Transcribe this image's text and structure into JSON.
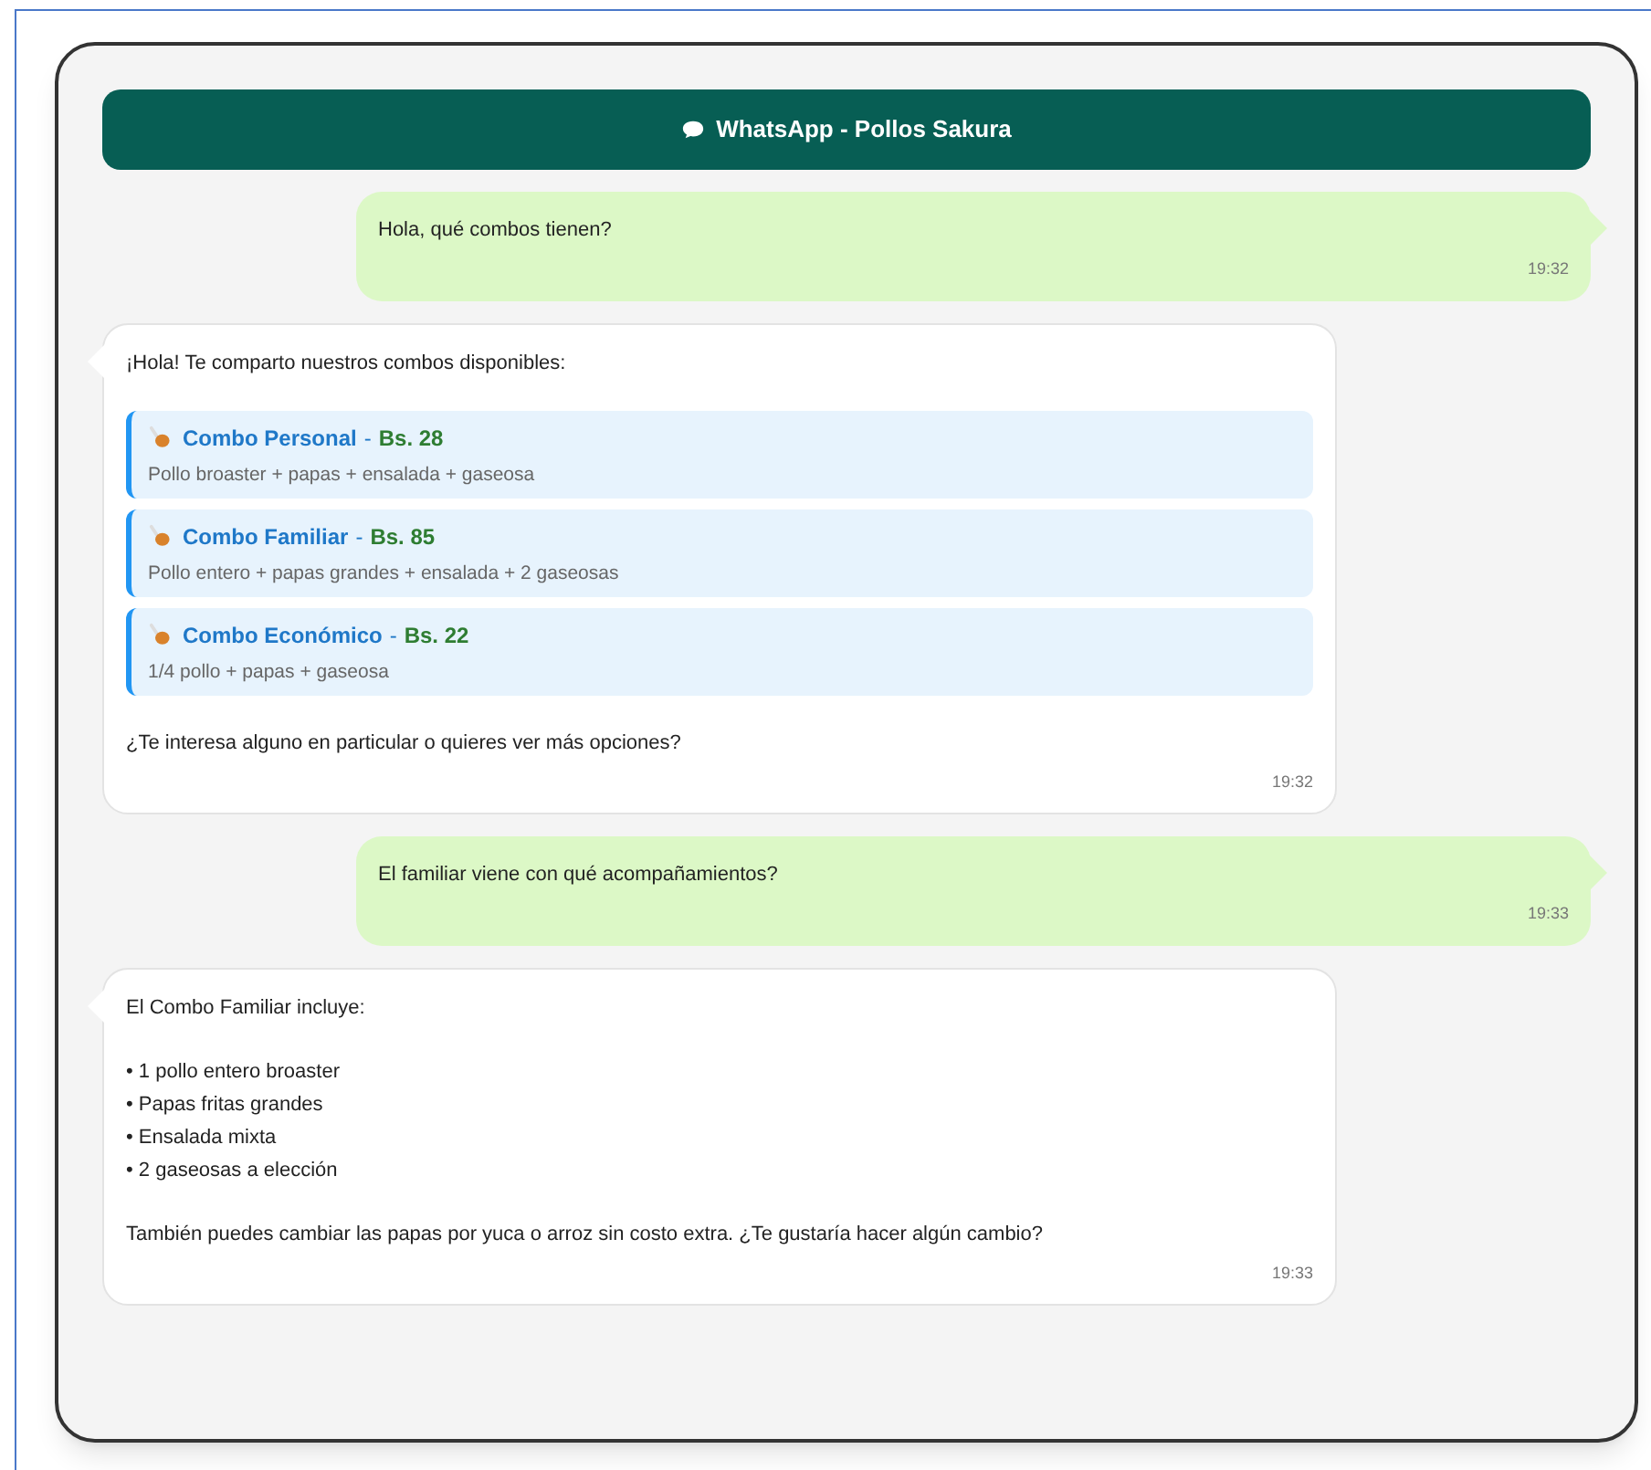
{
  "header": {
    "title": "WhatsApp - Pollos Sakura"
  },
  "messages": [
    {
      "kind": "sent",
      "lines": [
        {
          "kind": "text",
          "text": "Hola, qué combos tienen?"
        }
      ],
      "time": "19:32"
    },
    {
      "kind": "received",
      "lines": [
        {
          "kind": "text",
          "text": "¡Hola! Te comparto nuestros combos disponibles:"
        },
        {
          "kind": "combo",
          "name": "Combo Personal",
          "separator": "-",
          "price": "Bs. 28",
          "description": "Pollo broaster + papas + ensalada + gaseosa"
        },
        {
          "kind": "combo",
          "name": "Combo Familiar",
          "separator": "-",
          "price": "Bs. 85",
          "description": "Pollo entero + papas grandes + ensalada + 2 gaseosas"
        },
        {
          "kind": "combo",
          "name": "Combo Económico",
          "separator": "-",
          "price": "Bs. 22",
          "description": "1/4 pollo + papas + gaseosa"
        },
        {
          "kind": "text",
          "text": "¿Te interesa alguno en particular o quieres ver más opciones?"
        }
      ],
      "time": "19:32"
    },
    {
      "kind": "sent",
      "lines": [
        {
          "kind": "text",
          "text": "El familiar viene con qué acompañamientos?"
        }
      ],
      "time": "19:33"
    },
    {
      "kind": "received",
      "lines": [
        {
          "kind": "text",
          "text": "El Combo Familiar incluye:"
        },
        {
          "kind": "bullet",
          "text": "• 1 pollo entero broaster"
        },
        {
          "kind": "bullet",
          "text": "• Papas fritas grandes"
        },
        {
          "kind": "bullet",
          "text": "• Ensalada mixta"
        },
        {
          "kind": "bullet",
          "text": "• 2 gaseosas a elección"
        },
        {
          "kind": "text",
          "text": "También puedes cambiar las papas por yuca o arroz sin costo extra. ¿Te gustaría hacer algún cambio?"
        }
      ],
      "time": "19:33"
    }
  ]
}
